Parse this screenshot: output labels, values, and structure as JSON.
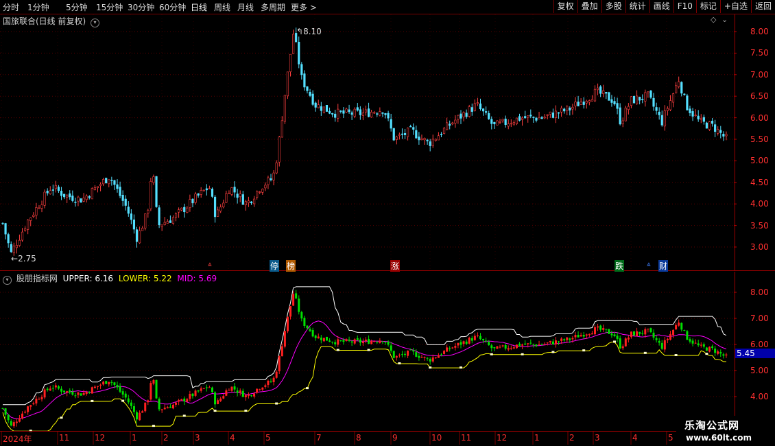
{
  "toolbar": {
    "periods": [
      "分时",
      "1分钟",
      "5分钟",
      "15分钟",
      "30分钟",
      "60分钟",
      "日线",
      "周线",
      "月线",
      "多周期",
      "更多 >"
    ],
    "active_period": "日线",
    "buttons": [
      "复权",
      "叠加",
      "多股",
      "统计",
      "画线",
      "F10",
      "标记",
      "+自选",
      "返回"
    ]
  },
  "main_panel": {
    "title": "国旅联合(日线 前复权)",
    "high_marker": "8.10",
    "low_marker": "2.75",
    "price_axis": [
      "8.00",
      "7.50",
      "7.00",
      "6.50",
      "6.00",
      "5.50",
      "5.00",
      "4.50",
      "4.00",
      "3.50",
      "3.00"
    ],
    "event_tags": [
      "停",
      "榜",
      "涨",
      "跌",
      "财"
    ]
  },
  "indicator_panel": {
    "name": "股朋指标网",
    "upper_label": "UPPER: 6.16",
    "lower_label": "LOWER: 5.22",
    "mid_label": "MID: 5.69",
    "upper_color": "#ffffff",
    "lower_color": "#ffff00",
    "mid_color": "#ff00ff",
    "price_axis": [
      "8.00",
      "7.00",
      "6.00",
      "5.00",
      "4.00"
    ],
    "current_price": "5.45"
  },
  "time_axis": [
    "2024年",
    "11",
    "12",
    "1",
    "2",
    "3",
    "4",
    "5",
    "7",
    "8",
    "9",
    "10",
    "11",
    "12",
    "1",
    "2",
    "3",
    "4",
    "5"
  ],
  "watermark": {
    "name": "乐淘公式网",
    "url": "www.60lt.com"
  },
  "chart_data": {
    "type": "candlestick",
    "security": "国旅联合",
    "period": "日线",
    "adjustment": "前复权",
    "main_ylim": [
      2.6,
      8.3
    ],
    "highest": 8.1,
    "lowest": 2.75,
    "last_close": 5.45,
    "bands": {
      "upper": 6.16,
      "lower": 5.22,
      "mid": 5.69
    },
    "close_path_monthly": [
      {
        "month": "2024年",
        "close": 3.4
      },
      {
        "month": "11",
        "close": 4.1
      },
      {
        "month": "12",
        "close": 4.5
      },
      {
        "month": "1",
        "close": 3.5
      },
      {
        "month": "2",
        "close": 3.6
      },
      {
        "month": "3",
        "close": 4.4
      },
      {
        "month": "4",
        "close": 4.1
      },
      {
        "month": "5",
        "close": 4.6
      },
      {
        "month": "7",
        "close": 6.3
      },
      {
        "month": "8",
        "close": 6.0
      },
      {
        "month": "9",
        "close": 5.5
      },
      {
        "month": "10",
        "close": 5.5
      },
      {
        "month": "11",
        "close": 6.0
      },
      {
        "month": "12",
        "close": 5.8
      },
      {
        "month": "1",
        "close": 6.0
      },
      {
        "month": "2",
        "close": 6.3
      },
      {
        "month": "3",
        "close": 6.2
      },
      {
        "month": "4",
        "close": 6.4
      },
      {
        "month": "5",
        "close": 5.45
      }
    ]
  }
}
